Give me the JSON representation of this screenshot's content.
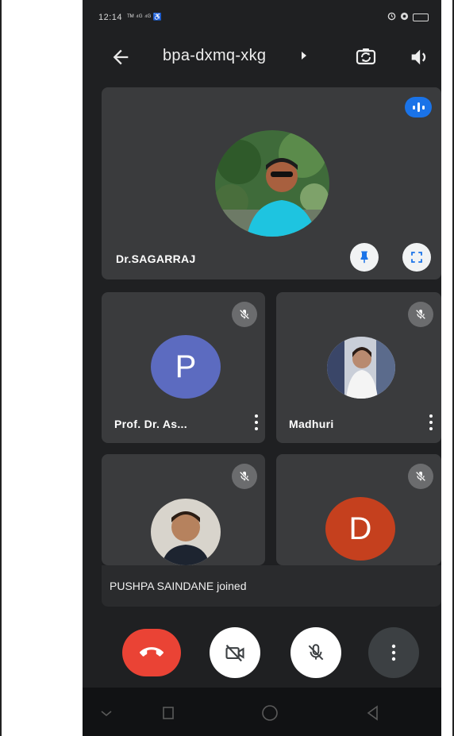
{
  "status_bar": {
    "time": "12:14",
    "extra": "ᵀᴹ ⁴ᴳ ⁴ᴳ ♿"
  },
  "top_bar": {
    "meeting_code": "bpa-dxmq-xkg",
    "back_icon": "arrow-left-icon",
    "switch_camera_icon": "switch-camera-icon",
    "audio_icon": "speaker-icon"
  },
  "participants": {
    "main": {
      "name": "Dr.SAGARRAJ",
      "speaking": true
    },
    "tile_a": {
      "name": "Prof. Dr. As...",
      "initial": "P",
      "avatar_color": "#5c6bc0",
      "muted": true
    },
    "tile_b": {
      "name": "Madhuri",
      "muted": true
    },
    "tile_c": {
      "name": "",
      "muted": true
    },
    "tile_d": {
      "name": "",
      "initial": "D",
      "avatar_color": "#c5401e",
      "muted": true
    }
  },
  "toast": {
    "message": "PUSHPA SAINDANE joined"
  },
  "controls": {
    "end_call_color": "#ea4335",
    "end_call_icon": "phone-hangup-icon",
    "camera_icon": "camera-off-icon",
    "mic_icon": "mic-off-icon",
    "more_icon": "more-vertical-icon"
  },
  "colors": {
    "background": "#1f2022",
    "tile": "#3a3b3d",
    "accent_blue": "#1a73e8"
  }
}
